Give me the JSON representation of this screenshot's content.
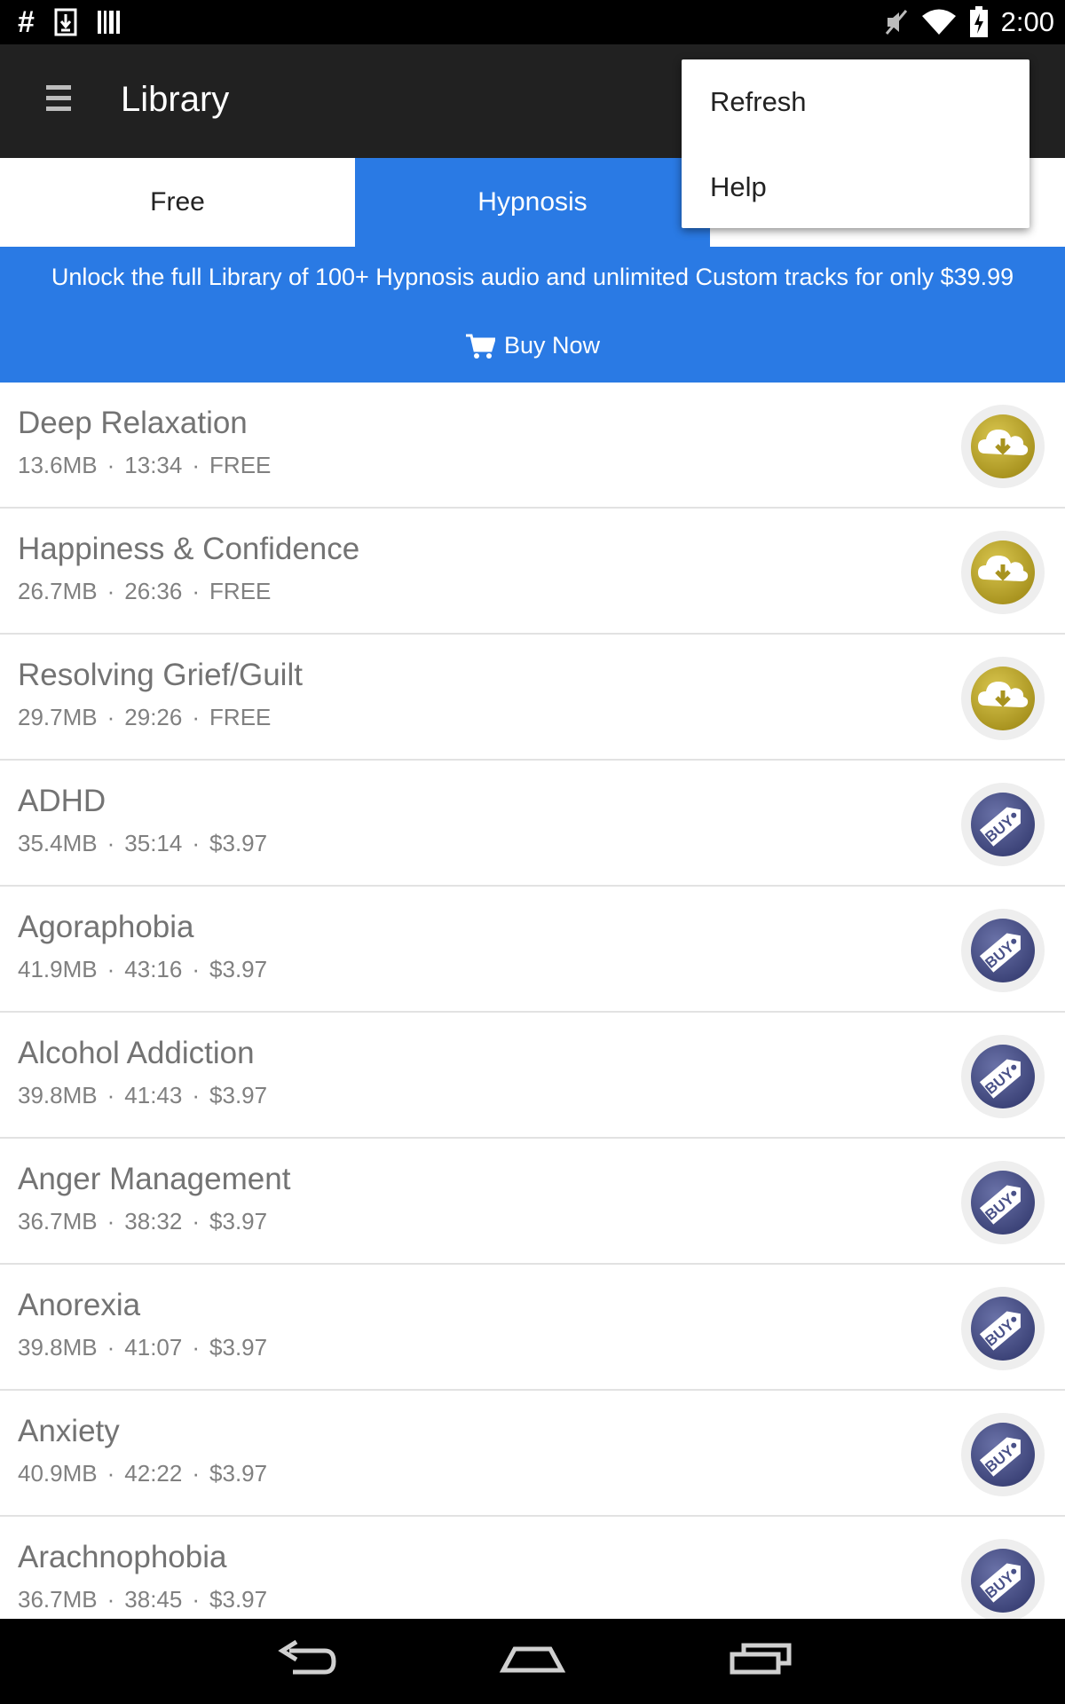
{
  "status_bar": {
    "left_icons": [
      "hash-icon",
      "download-notification-icon",
      "barcode-icon"
    ],
    "right_icons": [
      "mute-icon",
      "wifi-icon",
      "battery-charging-icon"
    ],
    "time": "2:00"
  },
  "app_bar": {
    "menu_icon": "hamburger-menu-icon",
    "title": "Library"
  },
  "tabs": [
    {
      "label": "Free",
      "selected": false
    },
    {
      "label": "Hypnosis",
      "selected": true
    }
  ],
  "promo": {
    "text": "Unlock the full Library of 100+ Hypnosis audio and unlimited Custom tracks for only $39.99",
    "buy_icon": "cart-icon",
    "buy_label": "Buy Now"
  },
  "overflow_menu": {
    "items": [
      "Refresh",
      "Help"
    ]
  },
  "tracks": [
    {
      "title": "Deep Relaxation",
      "size": "13.6MB",
      "duration": "13:34",
      "price": "FREE",
      "action": "download"
    },
    {
      "title": "Happiness & Confidence",
      "size": "26.7MB",
      "duration": "26:36",
      "price": "FREE",
      "action": "download"
    },
    {
      "title": "Resolving Grief/Guilt",
      "size": "29.7MB",
      "duration": "29:26",
      "price": "FREE",
      "action": "download"
    },
    {
      "title": "ADHD",
      "size": "35.4MB",
      "duration": "35:14",
      "price": "$3.97",
      "action": "buy"
    },
    {
      "title": "Agoraphobia",
      "size": "41.9MB",
      "duration": "43:16",
      "price": "$3.97",
      "action": "buy"
    },
    {
      "title": "Alcohol Addiction",
      "size": "39.8MB",
      "duration": "41:43",
      "price": "$3.97",
      "action": "buy"
    },
    {
      "title": "Anger Management",
      "size": "36.7MB",
      "duration": "38:32",
      "price": "$3.97",
      "action": "buy"
    },
    {
      "title": "Anorexia",
      "size": "39.8MB",
      "duration": "41:07",
      "price": "$3.97",
      "action": "buy"
    },
    {
      "title": "Anxiety",
      "size": "40.9MB",
      "duration": "42:22",
      "price": "$3.97",
      "action": "buy"
    },
    {
      "title": "Arachnophobia",
      "size": "36.7MB",
      "duration": "38:45",
      "price": "$3.97",
      "action": "buy"
    }
  ],
  "buy_badge_text": "BUY",
  "nav_bar": {
    "icons": [
      "back-icon",
      "home-icon",
      "recent-apps-icon"
    ]
  },
  "colors": {
    "accent_blue": "#2a7ae4",
    "app_bar": "#212121",
    "download_gold": "#c2ac33",
    "buy_indigo": "#4a5289"
  }
}
